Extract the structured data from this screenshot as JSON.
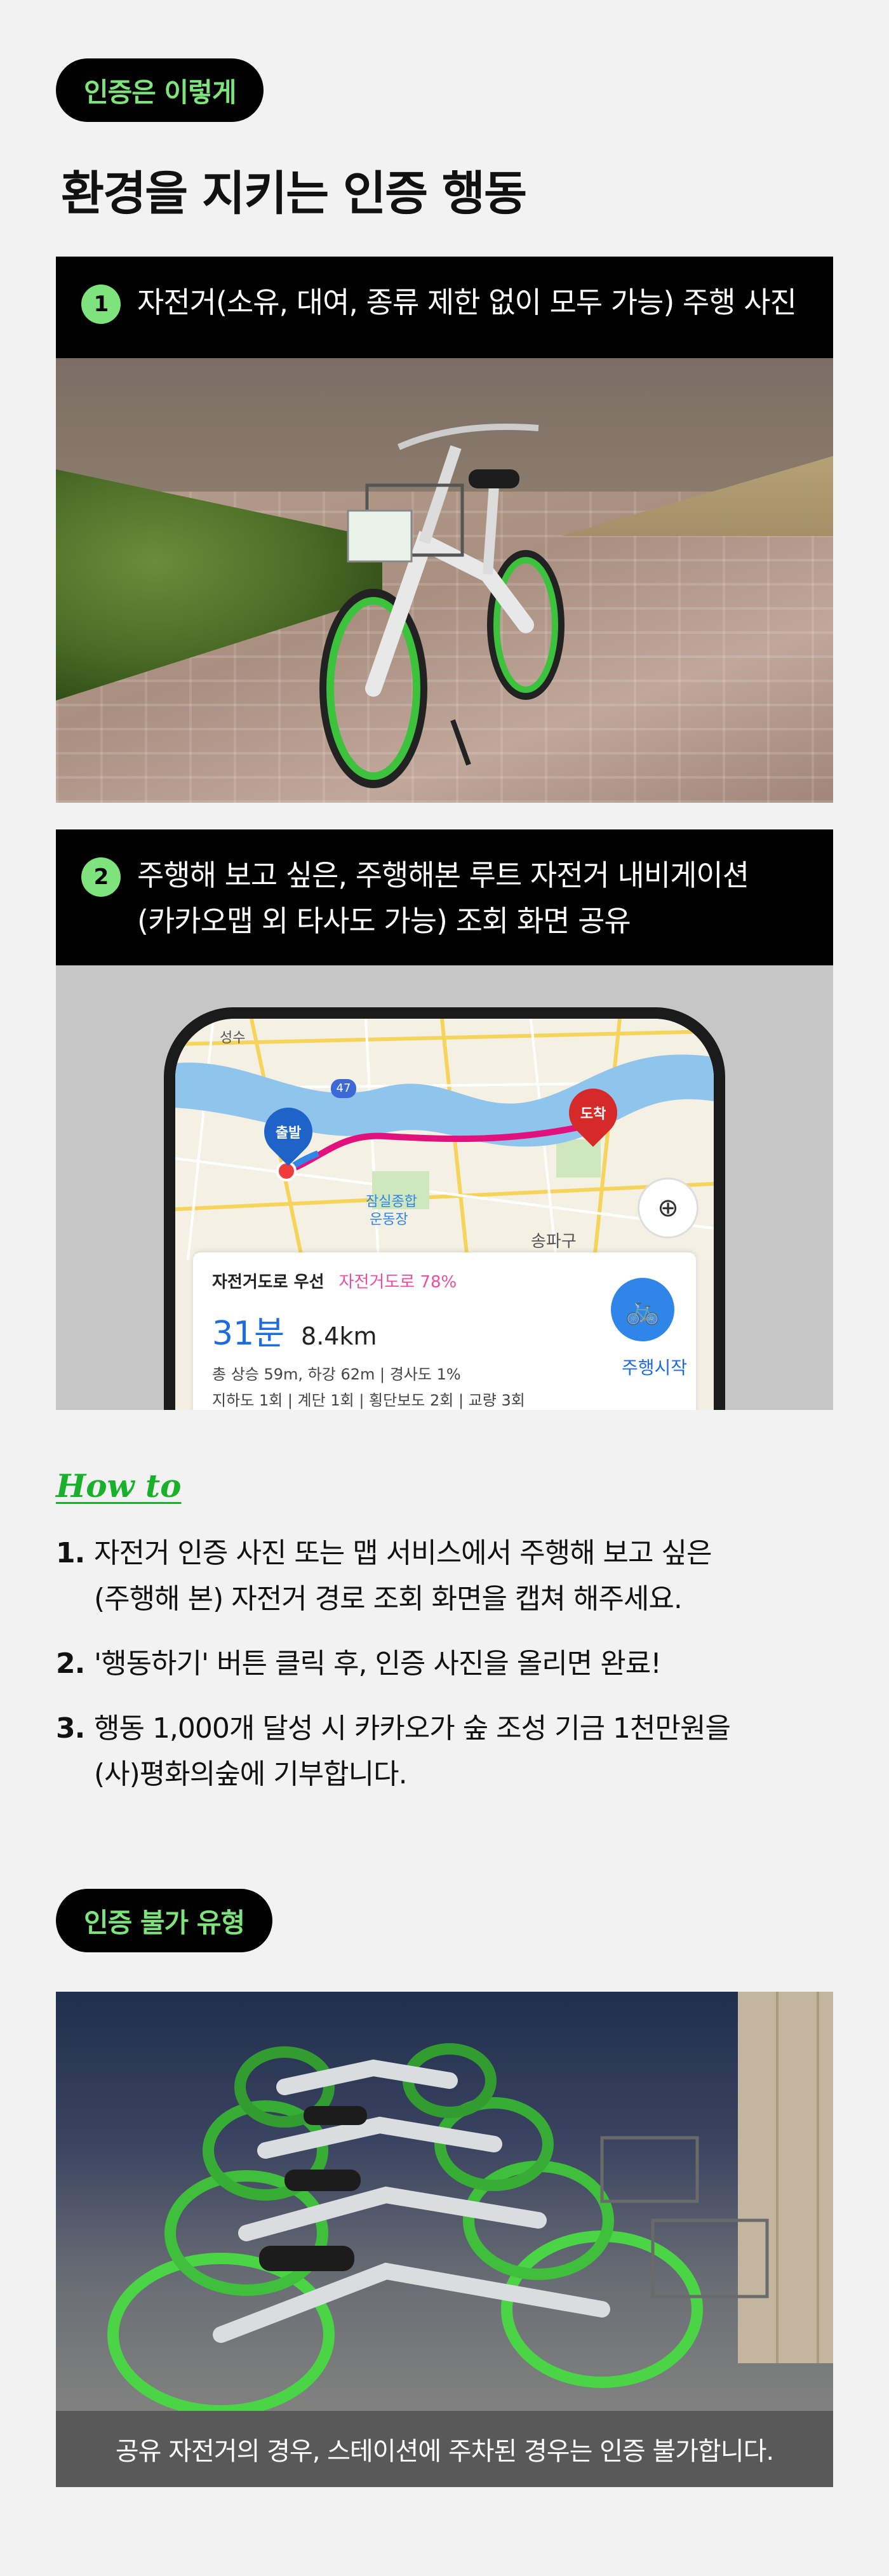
{
  "badge_verify": "인증은 이렇게",
  "headline": "환경을 지키는 인증 행동",
  "step1": {
    "number": "1",
    "text": "자전거(소유, 대여, 종류 제한 없이 모두 가능) 주행 사진"
  },
  "step2": {
    "number": "2",
    "line1": "주행해 보고 싶은, 주행해본 루트 자전거 내비게이션",
    "line2": "(카카오맵 외 타사도 가능) 조회 화면 공유"
  },
  "map": {
    "start_label": "출발",
    "end_label": "도착",
    "place_seongsu": "성수",
    "place_jamsil": "잠실종합",
    "place_jamsil2": "운동장",
    "place_songpa": "송파구",
    "road_number": "47",
    "route_pref": "자전거도로 우선",
    "route_pct": "자전거도로 78%",
    "time": "31분",
    "distance": "8.4km",
    "info1": "총 상승 59m, 하강 62m | 경사도 1%",
    "info2": "지하도 1회 | 계단 1회 | 횡단보도 2회 | 교량 3회",
    "start_button": "주행시작",
    "progress_pct": 78
  },
  "howto": {
    "title": "How to",
    "items": [
      {
        "n": "1.",
        "line1": "자전거 인증 사진 또는 맵 서비스에서 주행해 보고 싶은",
        "line2": "(주행해 본) 자전거 경로 조회 화면을 캡쳐 해주세요."
      },
      {
        "n": "2.",
        "line1": "'행동하기' 버튼 클릭 후, 인증 사진을 올리면 완료!",
        "line2": ""
      },
      {
        "n": "3.",
        "line1": "행동 1,000개 달성 시 카카오가 숲 조성 기금 1천만원을",
        "line2": "(사)평화의숲에 기부합니다."
      }
    ]
  },
  "badge_invalid": "인증 불가 유형",
  "invalid_caption": "공유 자전거의 경우, 스테이션에 주차된 경우는 인증 불가합니다.",
  "colors": {
    "accent_green": "#7ee37d",
    "howto_green": "#19b12b",
    "route_pink": "#e94fa1",
    "route_blue": "#2f86e8"
  }
}
